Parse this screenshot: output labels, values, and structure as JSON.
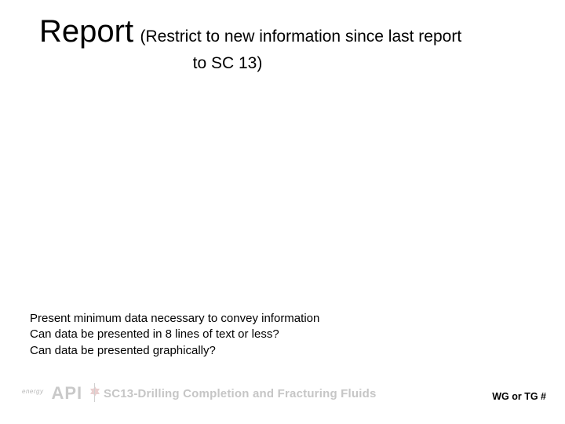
{
  "title": {
    "main": "Report",
    "sub_line1": "(Restrict to new information since last report",
    "sub_line2": "to SC 13)"
  },
  "body": {
    "line1": "Present minimum data necessary to convey information",
    "line2": "Can data be presented in 8 lines of text or less?",
    "line3": "Can data be presented graphically?"
  },
  "footer": {
    "energy_tag": "energy",
    "api_mark": "API",
    "subtitle": "SC13-Drilling Completion and Fracturing Fluids",
    "right": "WG or TG #"
  }
}
